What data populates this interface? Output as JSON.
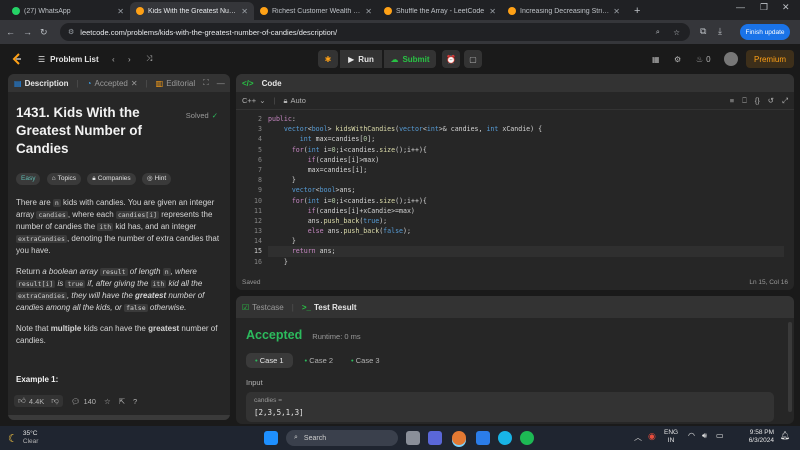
{
  "browser": {
    "tabs": [
      {
        "title": "(27) WhatsApp",
        "color": "#25d366",
        "active": false
      },
      {
        "title": "Kids With the Greatest Numbe",
        "color": "#ffa116",
        "active": true
      },
      {
        "title": "Richest Customer Wealth - Lee",
        "color": "#ffa116",
        "active": false
      },
      {
        "title": "Shuffle the Array - LeetCode",
        "color": "#ffa116",
        "active": false
      },
      {
        "title": "Increasing Decreasing String -",
        "color": "#ffa116",
        "active": false
      }
    ],
    "new_tab": "+",
    "url": "leetcode.com/problems/kids-with-the-greatest-number-of-candies/description/",
    "finish_update": "Finish update"
  },
  "nav": {
    "problem_list": "Problem List",
    "run": "Run",
    "submit": "Submit",
    "streak": "0",
    "premium": "Premium"
  },
  "left_tabs": {
    "description": "Description",
    "accepted": "Accepted",
    "editorial": "Editorial"
  },
  "problem": {
    "title": "1431. Kids With the Greatest Number of Candies",
    "solved": "Solved",
    "tags": [
      "Easy",
      "Topics",
      "Companies",
      "Hint"
    ],
    "p1_parts": [
      "There are ",
      "n",
      " kids with candies. You are given an integer array ",
      "candies",
      ", where each ",
      "candies[i]",
      " represents the number of candies the ",
      "ith",
      " kid has, and an integer ",
      "extraCandies",
      ", denoting the number of extra candies that you have."
    ],
    "p2_parts": [
      "Return ",
      "a boolean array",
      " result",
      " of length ",
      "n",
      ", where ",
      "result[i]",
      " is ",
      "true",
      " if, after giving the ",
      "ith",
      " kid all the ",
      "extraCandies",
      ", they will have the ",
      "greatest",
      " number of candies among all the kids, or ",
      "false",
      " otherwise."
    ],
    "p3_parts": [
      "Note that ",
      "multiple",
      " kids can have the ",
      "greatest",
      " number of candies."
    ],
    "example_heading": "Example 1:",
    "likes": "4.4K",
    "comments": "140"
  },
  "code_panel": {
    "title": "Code",
    "lang": "C++",
    "auto": "Auto",
    "status_left": "Saved",
    "status_right": "Ln 15, Col 16",
    "line_numbers": [
      "2",
      "3",
      "4",
      "5",
      "6",
      "7",
      "8",
      "9",
      "10",
      "11",
      "12",
      "13",
      "14",
      "15",
      "16"
    ],
    "lines": [
      "public:",
      "    vector<bool> kidsWithCandies(vector<int>& candies, int xCandie) {",
      "        int max=candies[0];",
      "      for(int i=0;i<candies.size();i++){",
      "          if(candies[i]>max)",
      "          max=candies[i];",
      "      }",
      "      vector<bool>ans;",
      "      for(int i=0;i<candies.size();i++){",
      "          if(candies[i]+xCandie>=max)",
      "          ans.push_back(true);",
      "          else ans.push_back(false);",
      "      }",
      "      return ans;",
      "    }"
    ]
  },
  "result_panel": {
    "tab_testcase": "Testcase",
    "tab_result": "Test Result",
    "status": "Accepted",
    "runtime": "Runtime: 0 ms",
    "cases": [
      "Case 1",
      "Case 2",
      "Case 3"
    ],
    "input_label": "Input",
    "param_name": "candies =",
    "param_value": "[2,3,5,1,3]"
  },
  "taskbar": {
    "weather_temp": "35°C",
    "weather_desc": "Clear",
    "search": "Search",
    "lang1": "ENG",
    "lang2": "IN",
    "time": "9:58 PM",
    "date": "6/3/2024"
  }
}
